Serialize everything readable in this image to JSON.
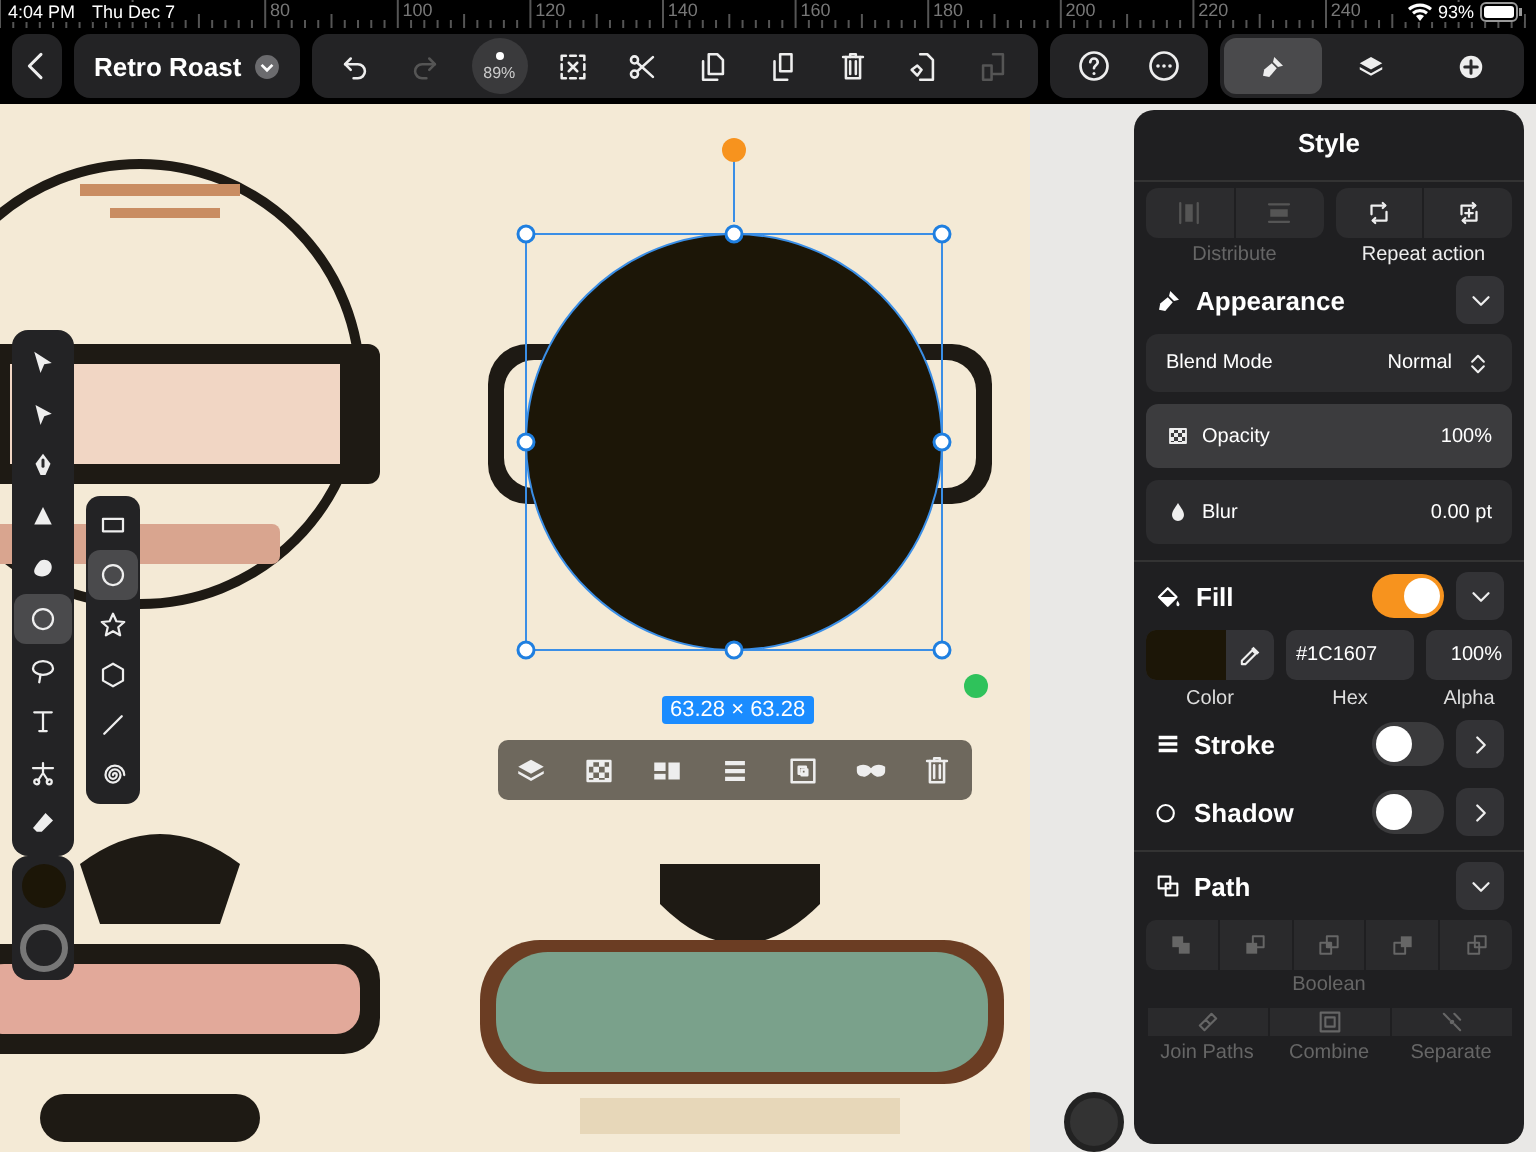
{
  "status_bar": {
    "time": "4:04 PM",
    "date": "Thu Dec 7",
    "battery": "93%"
  },
  "ruler": {
    "labels": [
      "80",
      "100",
      "120",
      "140",
      "160",
      "180",
      "200",
      "220",
      "240"
    ]
  },
  "toolbar": {
    "document_title": "Retro Roast",
    "zoom": "89%",
    "actions": [
      {
        "kind": "undo",
        "disabled": false
      },
      {
        "kind": "redo",
        "disabled": true
      },
      {
        "kind": "zoom"
      },
      {
        "kind": "deselect",
        "disabled": false
      },
      {
        "kind": "cut",
        "disabled": false
      },
      {
        "kind": "paste",
        "disabled": false
      },
      {
        "kind": "copy",
        "disabled": false
      },
      {
        "kind": "delete",
        "disabled": false
      },
      {
        "kind": "paste_style",
        "disabled": false
      },
      {
        "kind": "copy_style",
        "disabled": true
      }
    ],
    "extras": [
      {
        "kind": "help"
      },
      {
        "kind": "more"
      }
    ]
  },
  "inspector_tabs": [
    {
      "kind": "style",
      "selected": true
    },
    {
      "kind": "layers",
      "selected": false
    },
    {
      "kind": "add",
      "selected": false
    }
  ],
  "tools": [
    {
      "kind": "select",
      "selected": false
    },
    {
      "kind": "node",
      "selected": false
    },
    {
      "kind": "pen",
      "selected": false
    },
    {
      "kind": "brush",
      "selected": false
    },
    {
      "kind": "blob",
      "selected": false
    },
    {
      "kind": "shape",
      "selected": true
    },
    {
      "kind": "lasso",
      "selected": false
    },
    {
      "kind": "text",
      "selected": false
    },
    {
      "kind": "scissors",
      "selected": false
    },
    {
      "kind": "eraser",
      "selected": false
    }
  ],
  "shape_tools": [
    {
      "kind": "rectangle",
      "selected": false
    },
    {
      "kind": "ellipse",
      "selected": true
    },
    {
      "kind": "star",
      "selected": false
    },
    {
      "kind": "polygon",
      "selected": false
    },
    {
      "kind": "line",
      "selected": false
    },
    {
      "kind": "spiral",
      "selected": false
    }
  ],
  "selection": {
    "size": "63.28 × 63.28"
  },
  "context_menu": [
    {
      "kind": "arrange"
    },
    {
      "kind": "opacity"
    },
    {
      "kind": "align"
    },
    {
      "kind": "distribute"
    },
    {
      "kind": "duplicate"
    },
    {
      "kind": "mask"
    },
    {
      "kind": "delete"
    }
  ],
  "style_panel": {
    "title": "Style",
    "distribute": {
      "label": "Distribute",
      "disabled": true
    },
    "repeat_action": {
      "label": "Repeat action",
      "disabled": false
    },
    "appearance": {
      "title": "Appearance",
      "expanded": true,
      "rows": [
        {
          "kind": "blend",
          "label": "Blend Mode",
          "value": "Normal"
        },
        {
          "kind": "opacity",
          "label": "Opacity",
          "value": "100%"
        },
        {
          "kind": "blur",
          "label": "Blur",
          "value": "0.00 pt"
        }
      ]
    },
    "fill": {
      "title": "Fill",
      "on": true,
      "color": "#1c1607",
      "hex": "#1C1607",
      "alpha": "100%",
      "color_label": "Color",
      "hex_label": "Hex",
      "alpha_label": "Alpha"
    },
    "stroke": {
      "title": "Stroke",
      "on": false
    },
    "shadow": {
      "title": "Shadow",
      "on": false
    },
    "path": {
      "title": "Path",
      "expanded": true,
      "boolean_label": "Boolean",
      "actions": [
        {
          "kind": "join",
          "label": "Join Paths"
        },
        {
          "kind": "combine",
          "label": "Combine"
        },
        {
          "kind": "separate",
          "label": "Separate"
        }
      ]
    }
  }
}
